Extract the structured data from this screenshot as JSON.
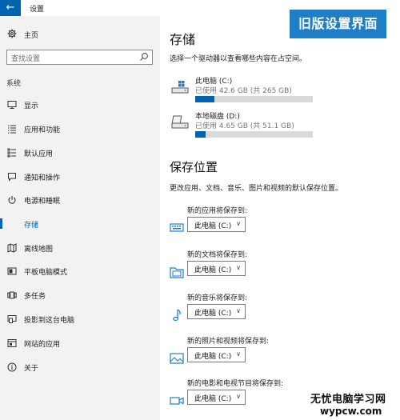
{
  "window": {
    "title": "设置"
  },
  "sidebar": {
    "home_label": "主页",
    "search_placeholder": "查找设置",
    "section_label": "系统",
    "items": [
      {
        "label": "显示",
        "icon": "monitor-icon"
      },
      {
        "label": "应用和功能",
        "icon": "list-icon"
      },
      {
        "label": "默认应用",
        "icon": "list-check-icon"
      },
      {
        "label": "通知和操作",
        "icon": "notification-icon"
      },
      {
        "label": "电源和睡眠",
        "icon": "power-icon"
      },
      {
        "label": "存储",
        "icon": "storage-icon",
        "active": true
      },
      {
        "label": "离线地图",
        "icon": "map-icon"
      },
      {
        "label": "平板电脑模式",
        "icon": "tablet-icon"
      },
      {
        "label": "多任务",
        "icon": "multitask-icon"
      },
      {
        "label": "投影到这台电脑",
        "icon": "project-icon"
      },
      {
        "label": "网站的应用",
        "icon": "website-apps-icon"
      },
      {
        "label": "关于",
        "icon": "info-icon"
      }
    ]
  },
  "banner": {
    "text": "旧版设置界面"
  },
  "storage": {
    "title": "存储",
    "subtitle": "选择一个驱动器以查看哪些内容在占空间。",
    "drives": [
      {
        "name": "此电脑 (C:)",
        "usage": "已使用 42.6 GB (共 265 GB)",
        "used_fraction": 0.161,
        "icon": "system-drive-icon"
      },
      {
        "name": "本地磁盘 (D:)",
        "usage": "已使用 4.65 GB (共 51.1 GB)",
        "used_fraction": 0.091,
        "icon": "local-disk-icon"
      }
    ]
  },
  "save_locations": {
    "title": "保存位置",
    "subtitle": "更改应用、文档、音乐、图片和视频的默认保存位置。",
    "rows": [
      {
        "label": "新的应用将保存到:",
        "value": "此电脑 (C:)",
        "icon": "apps-icon"
      },
      {
        "label": "新的文档将保存到:",
        "value": "此电脑 (C:)",
        "icon": "documents-icon"
      },
      {
        "label": "新的音乐将保存到:",
        "value": "此电脑 (C:)",
        "icon": "music-icon"
      },
      {
        "label": "新的照片和视频将保存到:",
        "value": "此电脑 (C:)",
        "icon": "photos-icon"
      },
      {
        "label": "新的电影和电视节目将保存到:",
        "value": "此电脑 (C:)",
        "icon": "movies-icon"
      }
    ]
  },
  "watermark": {
    "line1": "无忧电脑学习网",
    "line2": "wypcw.com"
  },
  "colors": {
    "accent": "#0063b1",
    "banner": "#1f7ec8",
    "sidebar_bg": "#f2f2f2",
    "bar_bg": "#d9d9d9"
  }
}
